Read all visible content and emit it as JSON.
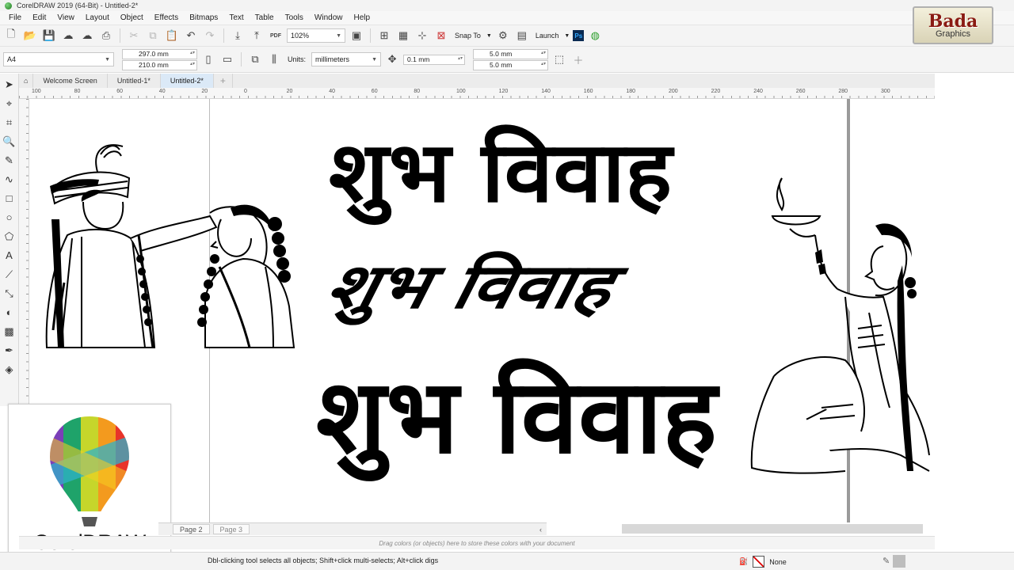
{
  "window": {
    "title": "CorelDRAW 2019 (64-Bit) - Untitled-2*"
  },
  "menu": [
    "File",
    "Edit",
    "View",
    "Layout",
    "Object",
    "Effects",
    "Bitmaps",
    "Text",
    "Table",
    "Tools",
    "Window",
    "Help"
  ],
  "standard_toolbar": {
    "zoom": "102%",
    "pdf_label": "PDF",
    "snap_to": "Snap To",
    "launch": "Launch",
    "ps_label": "Ps"
  },
  "property_bar": {
    "page_size": "A4",
    "width": "297.0 mm",
    "height": "210.0 mm",
    "units_label": "Units:",
    "units": "millimeters",
    "nudge": "0.1 mm",
    "dup_x": "5.0 mm",
    "dup_y": "5.0 mm"
  },
  "tabs": [
    {
      "label": "Welcome Screen",
      "active": false
    },
    {
      "label": "Untitled-1*",
      "active": false
    },
    {
      "label": "Untitled-2*",
      "active": true
    }
  ],
  "ruler_h_labels": [
    "100",
    "80",
    "60",
    "40",
    "20",
    "0",
    "20",
    "40",
    "60",
    "80",
    "100",
    "120",
    "140",
    "160",
    "180",
    "200",
    "220",
    "240",
    "260",
    "280",
    "300"
  ],
  "canvas_text": {
    "line1": "शुभ विवाह",
    "line2": "शुभ विवाह",
    "line3": "शुभ विवाह"
  },
  "page_tabs": [
    "Page 2",
    "Page 3"
  ],
  "palette_hint": "Drag colors (or objects) here to store these colors with your document",
  "status": {
    "hint": "Dbl-clicking tool selects all objects; Shift+click multi-selects; Alt+click digs",
    "fill": "None"
  },
  "logos": {
    "corel_text": "CorelDRAW",
    "bada_title": "Bada",
    "bada_sub": "Graphics"
  }
}
